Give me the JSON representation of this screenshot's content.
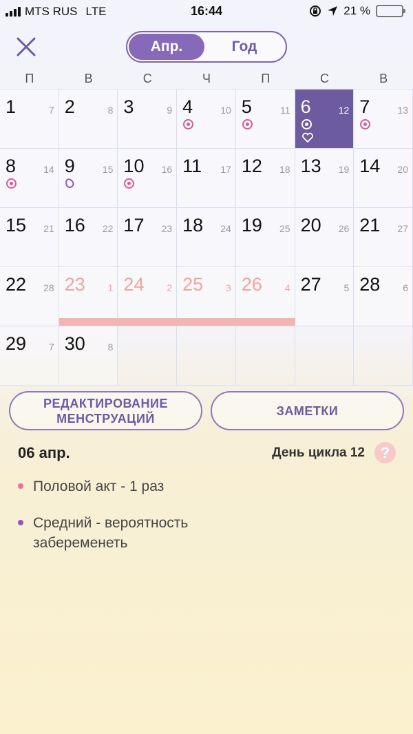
{
  "status_bar": {
    "carrier": "MTS RUS",
    "network": "LTE",
    "time": "16:44",
    "battery": "21 %",
    "battery_level": 0.21
  },
  "header": {
    "close_icon": "close-x-icon",
    "tabs": [
      {
        "label": "Апр.",
        "active": true
      },
      {
        "label": "Год",
        "active": false
      }
    ]
  },
  "weekdays": [
    "П",
    "В",
    "С",
    "Ч",
    "П",
    "С",
    "В"
  ],
  "calendar": {
    "days": [
      {
        "day": "1",
        "cycle": "7"
      },
      {
        "day": "2",
        "cycle": "8"
      },
      {
        "day": "3",
        "cycle": "9"
      },
      {
        "day": "4",
        "cycle": "10",
        "icon": "fertile-flower-icon"
      },
      {
        "day": "5",
        "cycle": "11",
        "icon": "fertile-flower-icon"
      },
      {
        "day": "6",
        "cycle": "12",
        "icon": "fertile-flower-icon",
        "heart": true,
        "selected": true
      },
      {
        "day": "7",
        "cycle": "13",
        "icon": "fertile-flower-icon"
      },
      {
        "day": "8",
        "cycle": "14",
        "icon": "fertile-flower-icon"
      },
      {
        "day": "9",
        "cycle": "15",
        "icon": "ovulation-egg-icon"
      },
      {
        "day": "10",
        "cycle": "16",
        "icon": "fertile-flower-icon"
      },
      {
        "day": "11",
        "cycle": "17"
      },
      {
        "day": "12",
        "cycle": "18"
      },
      {
        "day": "13",
        "cycle": "19"
      },
      {
        "day": "14",
        "cycle": "20"
      },
      {
        "day": "15",
        "cycle": "21"
      },
      {
        "day": "16",
        "cycle": "22"
      },
      {
        "day": "17",
        "cycle": "23"
      },
      {
        "day": "18",
        "cycle": "24"
      },
      {
        "day": "19",
        "cycle": "25"
      },
      {
        "day": "20",
        "cycle": "26"
      },
      {
        "day": "21",
        "cycle": "27"
      },
      {
        "day": "22",
        "cycle": "28"
      },
      {
        "day": "23",
        "cycle": "1",
        "period": true
      },
      {
        "day": "24",
        "cycle": "2",
        "period": true
      },
      {
        "day": "25",
        "cycle": "3",
        "period": true
      },
      {
        "day": "26",
        "cycle": "4",
        "period": true
      },
      {
        "day": "27",
        "cycle": "5"
      },
      {
        "day": "28",
        "cycle": "6"
      },
      {
        "day": "29",
        "cycle": "7"
      },
      {
        "day": "30",
        "cycle": "8"
      }
    ],
    "colors": {
      "selected": "#6d5b9f",
      "period": "#f0a4a2",
      "fertile": "#d85a9a",
      "ovulation": "#8b5bc0"
    }
  },
  "actions": {
    "edit_label_line1": "РЕДАКТИРОВАНИЕ",
    "edit_label_line2": "МЕНСТРУАЦИЙ",
    "notes_label": "ЗАМЕТКИ"
  },
  "details": {
    "date": "06 апр.",
    "cycle_day": "День цикла 12",
    "help": "?",
    "items": [
      {
        "text": "Половой акт - 1 раз",
        "color": "#ee6e9a"
      },
      {
        "text": "Средний - вероятность забеременеть",
        "color": "#9a4fc2"
      }
    ]
  }
}
